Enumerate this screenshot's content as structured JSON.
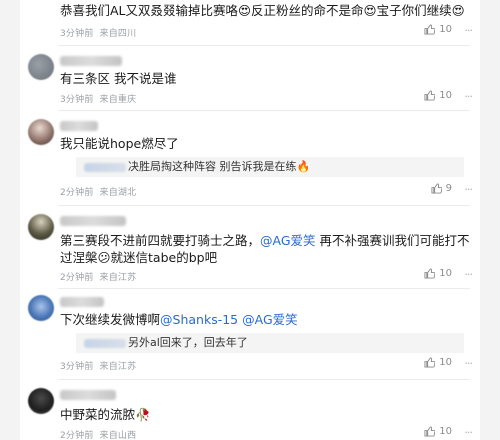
{
  "comments": [
    {
      "text": "恭喜我们AL又双叒叕输掉比赛咯😍反正粉丝的命不是命😍宝子你们继续😍",
      "time": "3分钟前",
      "location": "来自四川",
      "likes": "10"
    },
    {
      "username": "xxx",
      "text": "有三条区 我不说是谁",
      "time": "3分钟前",
      "location": "来自重庆",
      "likes": "10"
    },
    {
      "username": "xxx",
      "text": "我只能说hope燃尽了",
      "reply_user": "xxx",
      "reply_text": "决胜局掏这种阵容 别告诉我是在练🔥",
      "time": "2分钟前",
      "location": "来自湖北",
      "likes": "9"
    },
    {
      "username": "xxx",
      "text_line1_a": "第三赛段不进前四就要打骑士之路，",
      "text_line1_mention": "@AG爱笑",
      "text_line1_b": " 再不补强赛训我们可能打不",
      "text_line2": "过涅槃😕就迷信tabe的bp吧",
      "time": "2分钟前",
      "location": "来自江苏",
      "likes": "10"
    },
    {
      "username": "xxx",
      "text_a": "下次继续发微博啊",
      "mention1": "@Shanks-15",
      "mention2": "@AG爱笑",
      "reply_user": "xxx",
      "reply_text": "另外al回来了，回去年了",
      "time": "3分钟前",
      "location": "来自江苏",
      "likes": "10"
    },
    {
      "username": "xxx",
      "text": "中野菜的流脓🥀",
      "time": "2分钟前",
      "location": "来自山西",
      "likes": "10"
    }
  ],
  "icons": {
    "like": "thumbs-up-icon",
    "more": "more-dots-icon"
  }
}
